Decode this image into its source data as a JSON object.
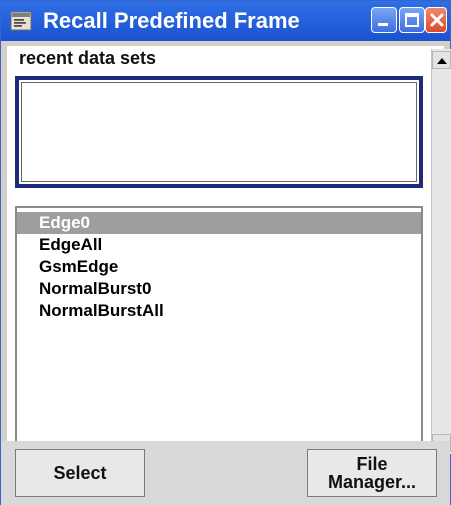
{
  "window": {
    "title": "Recall Predefined Frame",
    "icon": "app-icon",
    "controls": [
      "minimize",
      "maximize",
      "close"
    ]
  },
  "recent": {
    "label": "recent data sets"
  },
  "files": {
    "items": [
      {
        "label": "Edge0",
        "selected": true
      },
      {
        "label": "EdgeAll",
        "selected": false
      },
      {
        "label": "GsmEdge",
        "selected": false
      },
      {
        "label": "NormalBurst0",
        "selected": false
      },
      {
        "label": "NormalBurstAll",
        "selected": false
      }
    ]
  },
  "actions": {
    "select_label": "Select",
    "file_manager_line1": "File",
    "file_manager_line2": "Manager..."
  }
}
